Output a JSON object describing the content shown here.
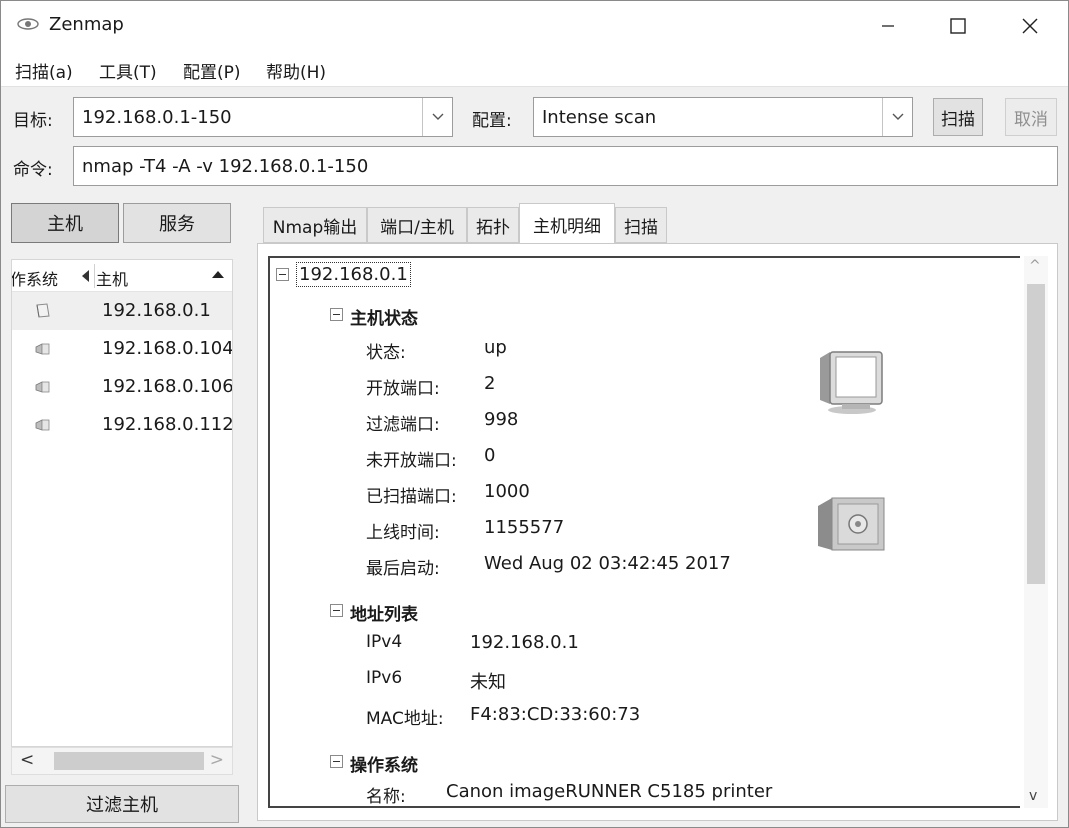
{
  "window": {
    "title": "Zenmap"
  },
  "menu": [
    "扫描(a)",
    "工具(T)",
    "配置(P)",
    "帮助(H)"
  ],
  "target": {
    "label": "目标:",
    "value": "192.168.0.1-150"
  },
  "profile": {
    "label": "配置:",
    "value": "Intense scan"
  },
  "buttons": {
    "scan": "扫描",
    "cancel": "取消",
    "filter_hosts": "过滤主机"
  },
  "command": {
    "label": "命令:",
    "value": "nmap -T4 -A -v 192.168.0.1-150"
  },
  "left_tabs": {
    "hosts": "主机",
    "services": "服务"
  },
  "host_list": {
    "col_os": "作系统",
    "col_host": "主机",
    "rows": [
      {
        "ip": "192.168.0.1",
        "selected": true
      },
      {
        "ip": "192.168.0.104",
        "selected": false
      },
      {
        "ip": "192.168.0.106",
        "selected": false
      },
      {
        "ip": "192.168.0.112",
        "selected": false
      }
    ]
  },
  "tabs": [
    {
      "label": "Nmap输出",
      "active": false
    },
    {
      "label": "端口/主机",
      "active": false
    },
    {
      "label": "拓扑",
      "active": false
    },
    {
      "label": "主机明细",
      "active": true
    },
    {
      "label": "扫描",
      "active": false
    }
  ],
  "details": {
    "host": "192.168.0.1",
    "status_section": {
      "title": "主机状态",
      "rows": [
        {
          "key": "状态:",
          "value": "up"
        },
        {
          "key": "开放端口:",
          "value": "2"
        },
        {
          "key": "过滤端口:",
          "value": "998"
        },
        {
          "key": "未开放端口:",
          "value": "0"
        },
        {
          "key": "已扫描端口:",
          "value": "1000"
        },
        {
          "key": "上线时间:",
          "value": "1155577"
        },
        {
          "key": "最后启动:",
          "value": "Wed Aug 02 03:42:45 2017"
        }
      ]
    },
    "address_section": {
      "title": "地址列表",
      "rows": [
        {
          "key": "IPv4",
          "value": "192.168.0.1"
        },
        {
          "key": "IPv6",
          "value": "未知"
        },
        {
          "key": "MAC地址:",
          "value": "F4:83:CD:33:60:73"
        }
      ]
    },
    "os_section": {
      "title": "操作系统",
      "rows": [
        {
          "key": "名称:",
          "value": "Canon imageRUNNER C5185 printer"
        }
      ]
    }
  },
  "colors": {
    "accent_border": "#444444",
    "selected_row": "#efefef",
    "button_face": "#e2e2e2"
  },
  "icons": [
    "eye-icon",
    "minimize-icon",
    "maximize-icon",
    "close-icon",
    "chevron-down-icon",
    "printer-icon",
    "computer-monitor-icon",
    "safe-icon"
  ]
}
